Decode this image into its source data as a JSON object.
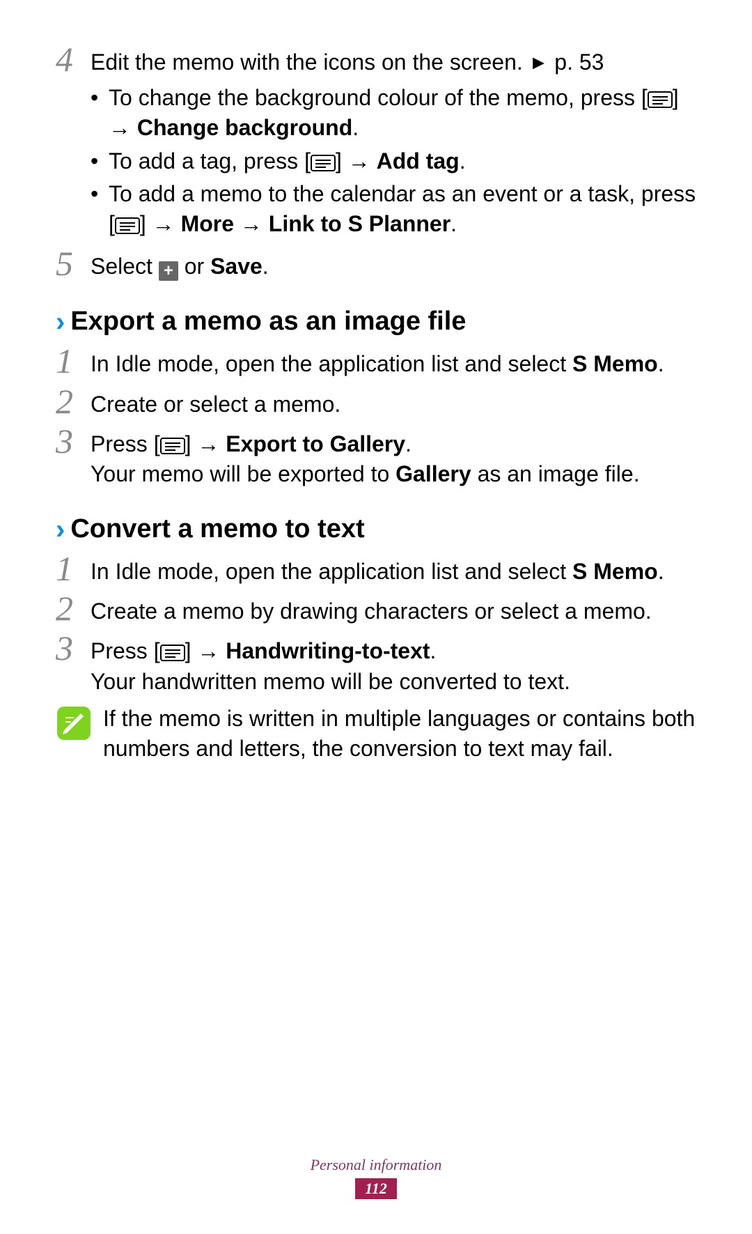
{
  "topSteps": {
    "step4": {
      "num": "4",
      "intro_pre": "Edit the memo with the icons on the screen. ",
      "intro_ref": "p. 53",
      "bullets": [
        {
          "pre": "To change the background colour of the memo, press [",
          "mid": "] → ",
          "bold": "Change background",
          "post": "."
        },
        {
          "pre": "To add a tag, press [",
          "mid": "] → ",
          "bold": "Add tag",
          "post": "."
        },
        {
          "pre": "To add a memo to the calendar as an event or a task, press [",
          "mid": "] → ",
          "bold": "More → Link to S Planner",
          "post": "."
        }
      ]
    },
    "step5": {
      "num": "5",
      "pre": "Select ",
      "mid": " or ",
      "bold": "Save",
      "post": "."
    }
  },
  "sectionA": {
    "title": "Export a memo as an image file",
    "steps": {
      "s1": {
        "num": "1",
        "pre": "In Idle mode, open the application list and select ",
        "bold": "S Memo",
        "post": "."
      },
      "s2": {
        "num": "2",
        "text": "Create or select a memo."
      },
      "s3": {
        "num": "3",
        "pre": "Press [",
        "mid": "] → ",
        "bold": "Export to Gallery",
        "post": ".",
        "line2_pre": "Your memo will be exported to ",
        "line2_bold": "Gallery",
        "line2_post": " as an image file."
      }
    }
  },
  "sectionB": {
    "title": "Convert a memo to text",
    "steps": {
      "s1": {
        "num": "1",
        "pre": "In Idle mode, open the application list and select ",
        "bold": "S Memo",
        "post": "."
      },
      "s2": {
        "num": "2",
        "text": "Create a memo by drawing characters or select a memo."
      },
      "s3": {
        "num": "3",
        "pre": "Press [",
        "mid": "] → ",
        "bold": "Handwriting-to-text",
        "post": ".",
        "line2": "Your handwritten memo will be converted to text."
      }
    },
    "note": "If the memo is written in multiple languages or contains both numbers and letters, the conversion to text may fail."
  },
  "footer": {
    "category": "Personal information",
    "page": "112"
  }
}
